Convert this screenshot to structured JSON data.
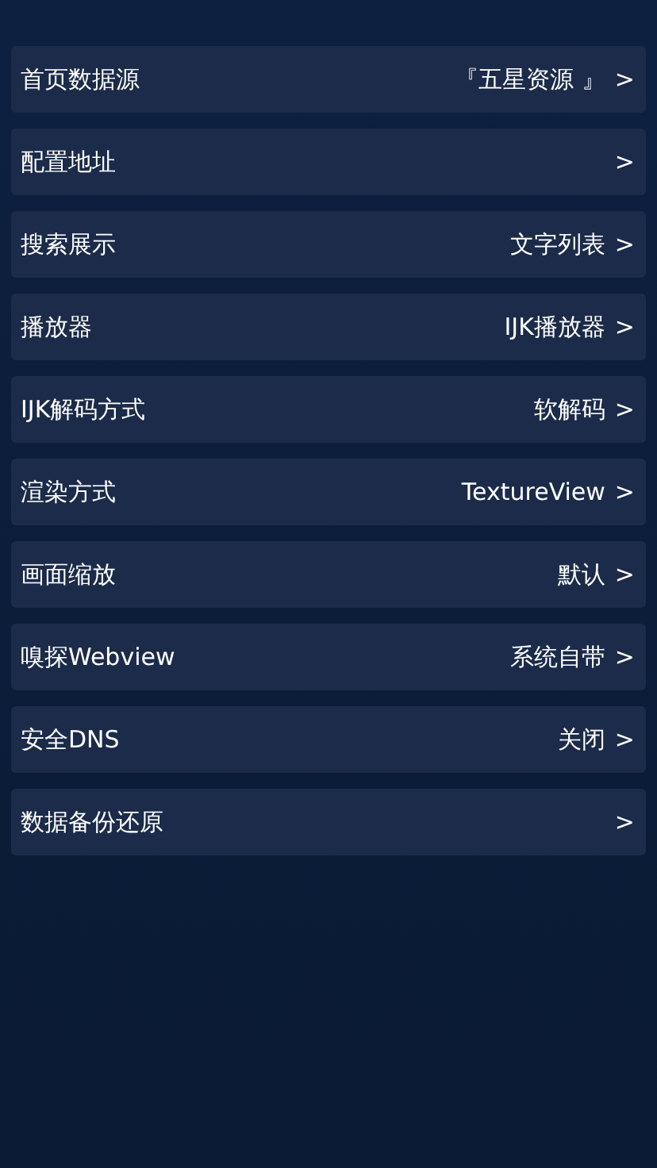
{
  "settings": [
    {
      "label": "首页数据源",
      "value": "『五星资源 』",
      "arrow": ">"
    },
    {
      "label": "配置地址",
      "arrow": ">"
    },
    {
      "label": "搜索展示",
      "value": "文字列表",
      "arrow": ">"
    },
    {
      "label": "播放器",
      "value": "IJK播放器",
      "arrow": ">"
    },
    {
      "label": "IJK解码方式",
      "value": "软解码",
      "arrow": ">"
    },
    {
      "label": "渲染方式",
      "value": "TextureView",
      "arrow": ">"
    },
    {
      "label": "画面缩放",
      "value": "默认",
      "arrow": ">"
    },
    {
      "label": "嗅探Webview",
      "value": "系统自带",
      "arrow": ">"
    },
    {
      "label": "安全DNS",
      "value": "关闭",
      "arrow": ">"
    },
    {
      "label": "数据备份还原",
      "arrow": ">"
    }
  ]
}
